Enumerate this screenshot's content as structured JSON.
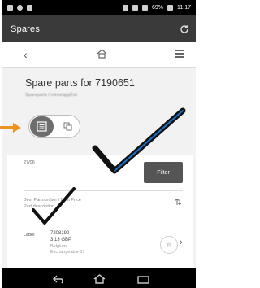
{
  "status": {
    "battery": "69%",
    "time": "11:17"
  },
  "appbar": {
    "title": "Spares",
    "refresh_icon": "refresh-icon"
  },
  "nav": {
    "back_icon": "chevron-left-icon",
    "home_icon": "home-icon",
    "menu_icon": "menu-icon"
  },
  "header": {
    "title": "Spare parts for 7190651",
    "subtitle": "Spareparts / mirrorappEvk"
  },
  "toggle": {
    "left_icon": "list-icon",
    "right_icon": "grid-icon"
  },
  "card": {
    "small_label": "27/06",
    "filter_label": "Filter",
    "sort_text_1": "Best    Partnumber / Best Price",
    "sort_text_2": "           Part description",
    "item": {
      "label": "Label",
      "id": "7208190",
      "price": "3.13 GBP",
      "info1": "Belgium",
      "info2": "Exchangeable 01"
    },
    "qty_placeholder": "qty"
  },
  "annotations": {
    "arrow_color": "#e8941f",
    "check_color": "#111111",
    "check_accent": "#1a73c9"
  }
}
